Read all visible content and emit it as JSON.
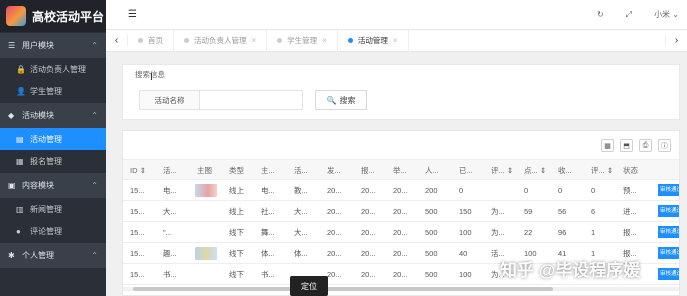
{
  "app": {
    "title": "高校活动平台"
  },
  "sidebar": {
    "groups": [
      {
        "label": "用户模块",
        "icon": "☰",
        "chevron": "⌃",
        "items": [
          {
            "label": "活动负责人管理",
            "icon": "🔒"
          },
          {
            "label": "学生管理",
            "icon": "👤"
          }
        ]
      },
      {
        "label": "活动模块",
        "icon": "◆",
        "chevron": "⌃",
        "items": [
          {
            "label": "活动管理",
            "icon": "▤",
            "active": true
          },
          {
            "label": "报名管理",
            "icon": "▦"
          }
        ]
      },
      {
        "label": "内容模块",
        "icon": "▣",
        "chevron": "⌃",
        "items": [
          {
            "label": "新闻管理",
            "icon": "▥"
          },
          {
            "label": "评论管理",
            "icon": "●"
          }
        ]
      },
      {
        "label": "个人管理",
        "icon": "✱",
        "chevron": "⌃",
        "items": []
      }
    ]
  },
  "header": {
    "menu_icon": "☰",
    "refresh_icon": "↻",
    "fullscreen_icon": "⤢",
    "user": "小米 ⌄"
  },
  "tabs": {
    "left_arrow": "‹",
    "right_arrow": "›",
    "items": [
      {
        "label": "首页",
        "closable": false
      },
      {
        "label": "活动负责人管理",
        "closable": true
      },
      {
        "label": "学生管理",
        "closable": true
      },
      {
        "label": "活动管理",
        "closable": true,
        "active": true
      }
    ],
    "close_glyph": "×"
  },
  "search": {
    "legend": "搜索信息",
    "field_label": "活动名称",
    "field_value": "",
    "button_label": "搜索",
    "button_icon": "🔍"
  },
  "table": {
    "tools": [
      "▦",
      "⬒",
      "⎙",
      "ⓘ"
    ],
    "columns": [
      "ID ⇕",
      "活...",
      "主图",
      "类型",
      "主...",
      "活...",
      "发...",
      "报...",
      "举...",
      "人...",
      "已...",
      "评... ⇕",
      "点... ⇕",
      "收...",
      "评... ⇕",
      "状态"
    ],
    "rows": [
      [
        "15...",
        "电...",
        "",
        "线上",
        "电...",
        "教...",
        "20...",
        "20...",
        "20...",
        "200",
        "0",
        "",
        "0",
        "0",
        "0",
        "预..."
      ],
      [
        "15...",
        "大...",
        "",
        "线上",
        "社...",
        "大...",
        "20...",
        "20...",
        "20...",
        "500",
        "150",
        "为...",
        "59",
        "56",
        "6",
        "进..."
      ],
      [
        "15...",
        "\"...",
        "",
        "线下",
        "舞...",
        "大...",
        "20...",
        "20...",
        "20...",
        "500",
        "100",
        "为...",
        "22",
        "96",
        "1",
        "报..."
      ],
      [
        "15...",
        "趣...",
        "",
        "线下",
        "体...",
        "体...",
        "20...",
        "20...",
        "20...",
        "500",
        "40",
        "活...",
        "100",
        "41",
        "1",
        "报..."
      ],
      [
        "15...",
        "书...",
        "",
        "线下",
        "书...",
        "",
        "20...",
        "20...",
        "20...",
        "500",
        "100",
        "为...",
        "",
        "",
        "",
        ""
      ]
    ],
    "thumbs": [
      true,
      false,
      false,
      true,
      false
    ],
    "op_label": "审核通过"
  },
  "tooltip": "定位",
  "watermark": "知乎 @毕设程序媛"
}
